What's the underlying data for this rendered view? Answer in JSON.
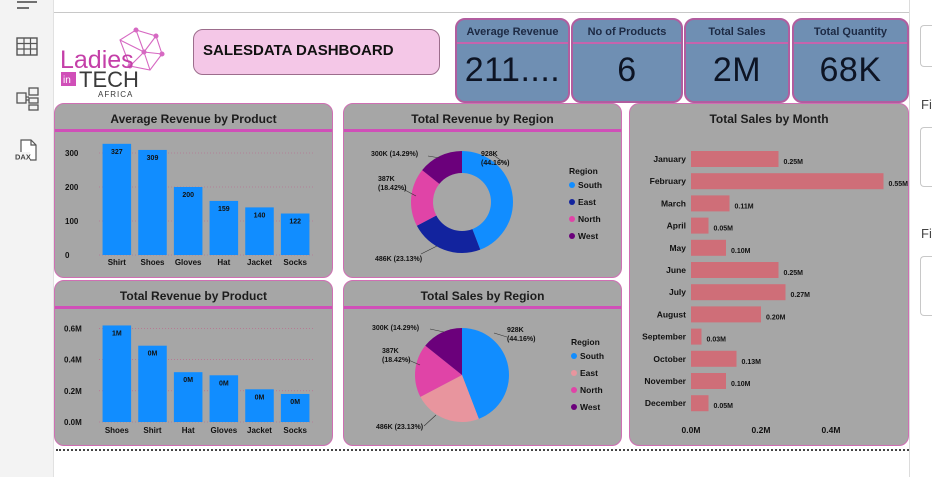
{
  "dashboard_title": "SALESDATA DASHBOARD",
  "logo": {
    "line1": "Ladies",
    "line2": "in",
    "line3": "TECH",
    "line4": "AFRICA"
  },
  "left_icons": [
    "report-view-icon",
    "table-view-icon",
    "model-view-icon",
    "dax-query-icon"
  ],
  "dax_label": "DAX",
  "right_pane": {
    "label1": "Fi",
    "label2": "Fi"
  },
  "cards": [
    {
      "title": "Average Revenue",
      "value": "211...."
    },
    {
      "title": "No of Products",
      "value": "6"
    },
    {
      "title": "Total Sales",
      "value": "2M"
    },
    {
      "title": "Total Quantity",
      "value": "68K"
    }
  ],
  "colors": {
    "accent_pink": "#d04fb8",
    "bar_blue": "#118dff",
    "bar_red": "#cf6e78",
    "panel": "#a6a6a6",
    "card": "#6f8fb3",
    "south": "#118dff",
    "east": "#12239e",
    "north": "#e044a7",
    "west": "#6b007b",
    "east_pink": "#e8959e"
  },
  "chart_data": [
    {
      "type": "bar",
      "title": "Average Revenue by Product",
      "categories": [
        "Shirt",
        "Shoes",
        "Gloves",
        "Hat",
        "Jacket",
        "Socks"
      ],
      "values": [
        327,
        309,
        200,
        159,
        140,
        122
      ],
      "data_labels": [
        "327",
        "309",
        "200",
        "159",
        "140",
        "122"
      ],
      "yticks": [
        "300",
        "200",
        "100",
        "0"
      ],
      "ylim": [
        0,
        350
      ]
    },
    {
      "type": "pie",
      "subtype": "donut",
      "title": "Total Revenue by Region",
      "legend_title": "Region",
      "categories": [
        "South",
        "East",
        "North",
        "West"
      ],
      "values": [
        928,
        486,
        387,
        300
      ],
      "labels": [
        "928K\n(44.16%)",
        "486K (23.13%)",
        "387K\n(18.42%)",
        "300K (14.29%)"
      ],
      "legend": "right"
    },
    {
      "type": "bar",
      "orientation": "horizontal",
      "title": "Total Sales by Month",
      "categories": [
        "January",
        "February",
        "March",
        "April",
        "May",
        "June",
        "July",
        "August",
        "September",
        "October",
        "November",
        "December"
      ],
      "values": [
        0.25,
        0.55,
        0.11,
        0.05,
        0.1,
        0.25,
        0.27,
        0.2,
        0.03,
        0.13,
        0.1,
        0.05
      ],
      "data_labels": [
        "0.25M",
        "0.55M",
        "0.11M",
        "0.05M",
        "0.10M",
        "0.25M",
        "0.27M",
        "0.20M",
        "0.03M",
        "0.13M",
        "0.10M",
        "0.05M"
      ],
      "xticks": [
        "0.0M",
        "0.2M",
        "0.4M"
      ],
      "xlim": [
        0,
        0.6
      ]
    },
    {
      "type": "bar",
      "title": "Total Revenue by Product",
      "categories": [
        "Shoes",
        "Shirt",
        "Hat",
        "Gloves",
        "Jacket",
        "Socks"
      ],
      "values": [
        0.62,
        0.49,
        0.32,
        0.3,
        0.21,
        0.18
      ],
      "data_labels": [
        "1M",
        "0M",
        "0M",
        "0M",
        "0M",
        "0M"
      ],
      "yticks": [
        "0.6M",
        "0.4M",
        "0.2M",
        "0.0M"
      ],
      "ylim": [
        0,
        0.7
      ]
    },
    {
      "type": "pie",
      "title": "Total Sales by Region",
      "legend_title": "Region",
      "categories": [
        "South",
        "East",
        "North",
        "West"
      ],
      "values": [
        928,
        486,
        387,
        300
      ],
      "labels": [
        "928K\n(44.16%)",
        "486K (23.13%)",
        "387K\n(18.42%)",
        "300K (14.29%)"
      ],
      "legend": "right"
    }
  ]
}
